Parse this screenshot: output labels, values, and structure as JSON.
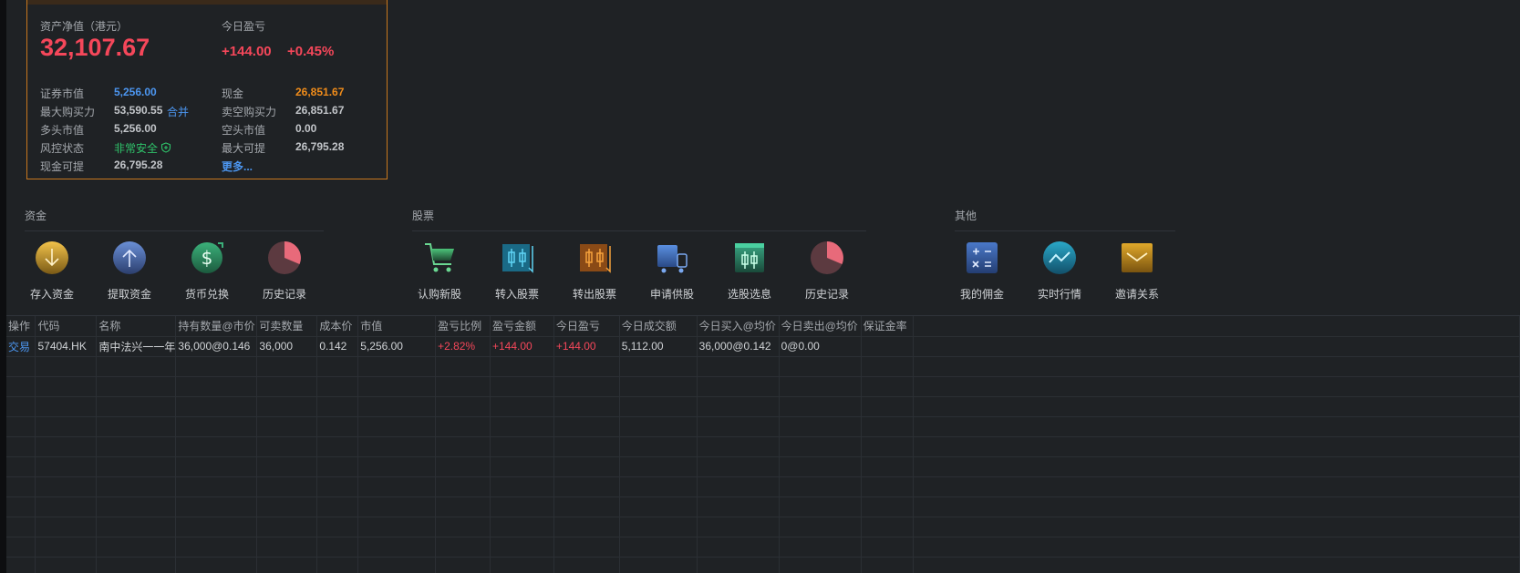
{
  "account": {
    "net_assets_label": "资产净值（港元）",
    "net_assets_value": "32,107.67",
    "today_pnl_label": "今日盈亏",
    "today_pnl_amount": "+144.00",
    "today_pnl_pct": "+0.45%",
    "rows_left": [
      {
        "label": "证券市值",
        "value": "5,256.00",
        "color": "#4c96f0"
      },
      {
        "label": "最大购买力",
        "value": "53,590.55",
        "extra": "合并"
      },
      {
        "label": "多头市值",
        "value": "5,256.00"
      },
      {
        "label": "风控状态",
        "value": "非常安全",
        "color": "#2fc36a",
        "icon": "shield-icon"
      },
      {
        "label": "现金可提",
        "value": "26,795.28"
      }
    ],
    "rows_right": [
      {
        "label": "现金",
        "value": "26,851.67",
        "color": "#f08c1a"
      },
      {
        "label": "卖空购买力",
        "value": "26,851.67"
      },
      {
        "label": "空头市值",
        "value": "0.00"
      },
      {
        "label": "最大可提",
        "value": "26,795.28"
      }
    ],
    "more_link": "更多..."
  },
  "sections": {
    "funds": {
      "title": "资金",
      "items": [
        {
          "label": "存入资金",
          "icon": "deposit-arrow-icon"
        },
        {
          "label": "提取资金",
          "icon": "withdraw-arrow-icon"
        },
        {
          "label": "货币兑换",
          "icon": "currency-exchange-icon"
        },
        {
          "label": "历史记录",
          "icon": "history-pie-icon"
        }
      ]
    },
    "stocks": {
      "title": "股票",
      "items": [
        {
          "label": "认购新股",
          "icon": "shopping-cart-icon"
        },
        {
          "label": "转入股票",
          "icon": "transfer-in-candlestick-icon"
        },
        {
          "label": "转出股票",
          "icon": "transfer-out-candlestick-icon"
        },
        {
          "label": "申请供股",
          "icon": "truck-icon"
        },
        {
          "label": "选股选息",
          "icon": "candlestick-chart-icon"
        },
        {
          "label": "历史记录",
          "icon": "history-pie-icon"
        }
      ]
    },
    "other": {
      "title": "其他",
      "items": [
        {
          "label": "我的佣金",
          "icon": "calculator-icon"
        },
        {
          "label": "实时行情",
          "icon": "realtime-line-icon"
        },
        {
          "label": "邀请关系",
          "icon": "envelope-icon"
        }
      ]
    }
  },
  "table": {
    "headers": [
      "操作",
      "代码",
      "名称",
      "持有数量@市价",
      "可卖数量",
      "成本价",
      "市值",
      "盈亏比例",
      "盈亏金额",
      "今日盈亏",
      "今日成交额",
      "今日买入@均价",
      "今日卖出@均价",
      "保证金率"
    ],
    "rows": [
      {
        "action": "交易",
        "code": "57404.HK",
        "name": "南中法兴一一年",
        "qty_price": "36,000@0.146",
        "sellable": "36,000",
        "cost": "0.142",
        "market_value": "5,256.00",
        "pnl_ratio": "+2.82%",
        "pnl_amount": "+144.00",
        "today_pnl": "+144.00",
        "today_turnover": "5,112.00",
        "today_buy": "36,000@0.142",
        "today_sell": "0@0.00",
        "margin": ""
      }
    ]
  }
}
